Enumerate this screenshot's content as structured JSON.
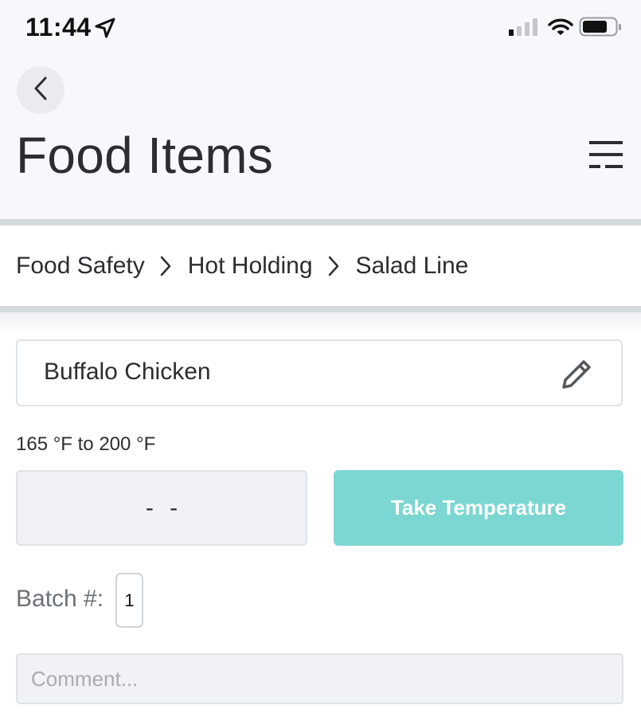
{
  "status_bar": {
    "time": "11:44",
    "icons": [
      "location-arrow-icon",
      "cellular-signal-icon",
      "wifi-icon",
      "battery-icon"
    ]
  },
  "header": {
    "back_icon": "chevron-left-icon",
    "title": "Food Items",
    "menu_icon": "filter-menu-icon"
  },
  "breadcrumb": {
    "items": [
      "Food Safety",
      "Hot Holding",
      "Salad Line"
    ],
    "separator_icon": "chevron-right-icon"
  },
  "food_item": {
    "name": "Buffalo Chicken",
    "edit_icon": "pencil-icon",
    "temperature_range": "165 °F to 200 °F",
    "current_reading": "- -",
    "take_temperature_label": "Take Temperature",
    "batch_label": "Batch #:",
    "batch_value": "1",
    "comment_placeholder": "Comment..."
  },
  "colors": {
    "header_background": "#f7f8fc",
    "divider": "#d3dade",
    "accent_button": "#7cd6d2",
    "field_background": "#f0f2f5"
  }
}
